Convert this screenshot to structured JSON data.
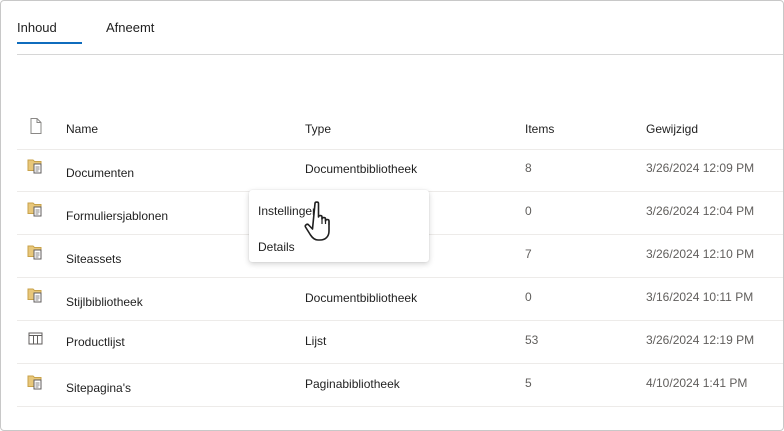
{
  "tabs": [
    {
      "label": "Inhoud",
      "active": true
    },
    {
      "label": "Afneemt",
      "active": false
    }
  ],
  "table": {
    "headers": {
      "icon": "file-icon",
      "name": "Name",
      "type": "Type",
      "items": "Items",
      "modified": "Gewijzigd"
    },
    "rows": [
      {
        "icon": "library-icon",
        "name": "Documenten",
        "type": "Documentbibliotheek",
        "items": "8",
        "modified": "3/26/2024 12:09 PM"
      },
      {
        "icon": "library-icon",
        "name": "Formuliersjablonen",
        "type": "",
        "items": "0",
        "modified": "3/26/2024 12:04 PM"
      },
      {
        "icon": "library-icon",
        "name": "Siteassets",
        "type": "",
        "items": "7",
        "modified": "3/26/2024 12:10 PM"
      },
      {
        "icon": "library-icon",
        "name": "Stijlbibliotheek",
        "type": "Documentbibliotheek",
        "items": "0",
        "modified": "3/16/2024 10:11 PM"
      },
      {
        "icon": "list-icon",
        "name": "Productlijst",
        "type": "Lijst",
        "items": "53",
        "modified": "3/26/2024 12:19 PM"
      },
      {
        "icon": "library-icon",
        "name": "Sitepagina's",
        "type": "Paginabibliotheek",
        "items": "5",
        "modified": "4/10/2024 1:41 PM"
      }
    ]
  },
  "context_menu": {
    "items": [
      {
        "label": "Instellingen"
      },
      {
        "label": "Details"
      }
    ]
  },
  "colors": {
    "accent": "#0f6cbd",
    "folder": "#c8a24a"
  }
}
